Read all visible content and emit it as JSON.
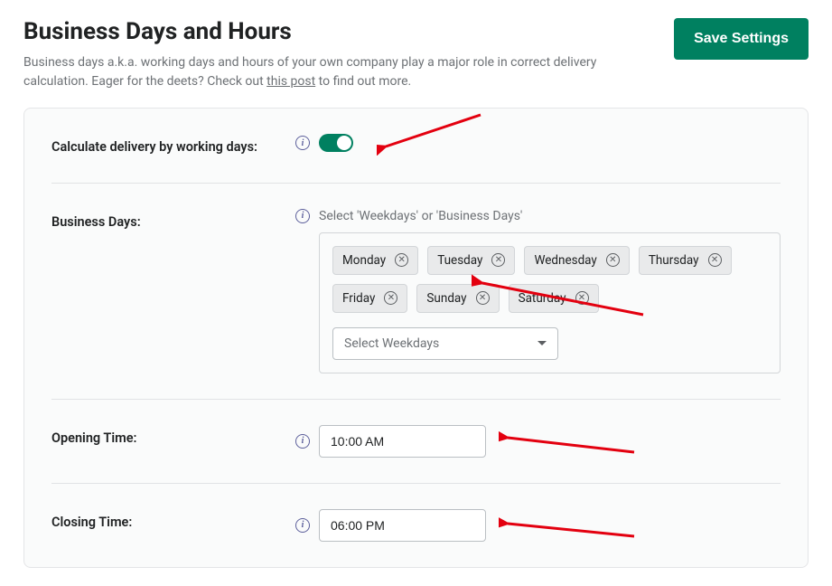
{
  "header": {
    "title": "Business Days and Hours",
    "desc_pre": "Business days a.k.a. working days and hours of your own company play a major role in correct delivery calculation. Eager for the deets? Check out ",
    "desc_link": "this post",
    "desc_post": " to find out more.",
    "save_label": "Save Settings"
  },
  "rows": {
    "calc": {
      "label": "Calculate delivery by working days:"
    },
    "biz": {
      "label": "Business Days:",
      "hint": "Select 'Weekdays' or 'Business Days'",
      "chips": [
        "Monday",
        "Tuesday",
        "Wednesday",
        "Thursday",
        "Friday",
        "Sunday",
        "Saturday"
      ],
      "select_placeholder": "Select Weekdays"
    },
    "open": {
      "label": "Opening Time:",
      "value": "10:00 AM"
    },
    "close": {
      "label": "Closing Time:",
      "value": "06:00 PM"
    }
  }
}
